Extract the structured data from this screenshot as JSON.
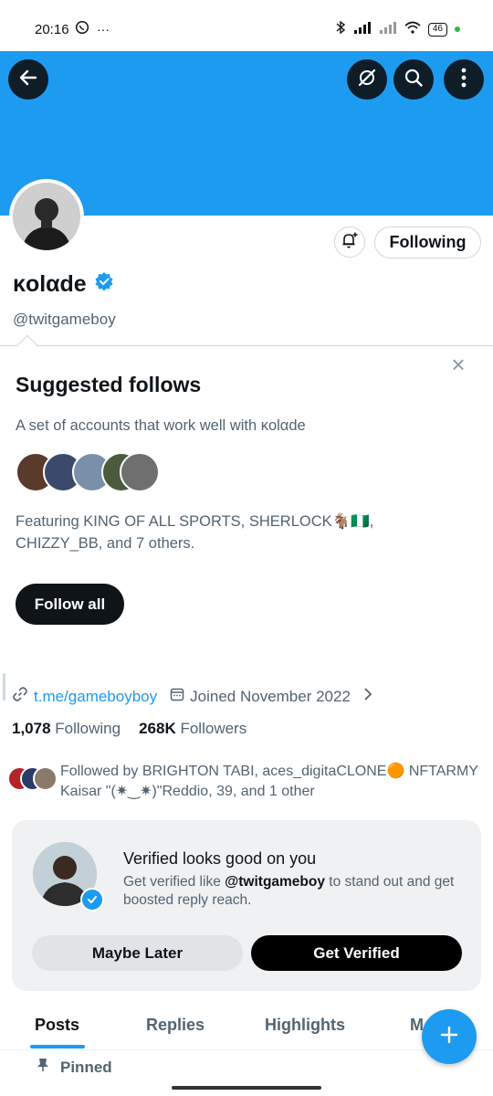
{
  "status_bar": {
    "time": "20:16",
    "battery": "46"
  },
  "header": {
    "banner_color": "#1d9bf0"
  },
  "profile": {
    "display_name": "κolαde",
    "handle": "@twitgameboy",
    "following_button": "Following",
    "link": "t.me/gameboyboy",
    "joined": "Joined November 2022",
    "following_count": "1,078",
    "following_label": "Following",
    "followers_count": "268K",
    "followers_label": "Followers",
    "followed_by": "Followed by BRIGHTON TABI, aces_digitaCLONE🟠 NFTARMY Kaisar \"(✷‿✷)\"Reddio, 39, and 1 other"
  },
  "suggested": {
    "title": "Suggested follows",
    "description": "A set of accounts that work well with κolαde",
    "featuring": "Featuring KING OF ALL SPORTS, SHERLOCK🐐🇳🇬, CHIZZY_BB, and 7 others.",
    "follow_all": "Follow all"
  },
  "verified_card": {
    "title": "Verified looks good on you",
    "desc_prefix": "Get verified like ",
    "desc_handle": "@twitgameboy",
    "desc_suffix": " to stand out and get boosted reply reach.",
    "maybe_later": "Maybe Later",
    "get_verified": "Get Verified"
  },
  "tabs": [
    {
      "label": "Posts"
    },
    {
      "label": "Replies"
    },
    {
      "label": "Highlights"
    },
    {
      "label": "M"
    }
  ],
  "pinned_label": "Pinned",
  "colors": {
    "accent": "#1d9bf0",
    "text": "#0f1419",
    "muted": "#536471"
  }
}
